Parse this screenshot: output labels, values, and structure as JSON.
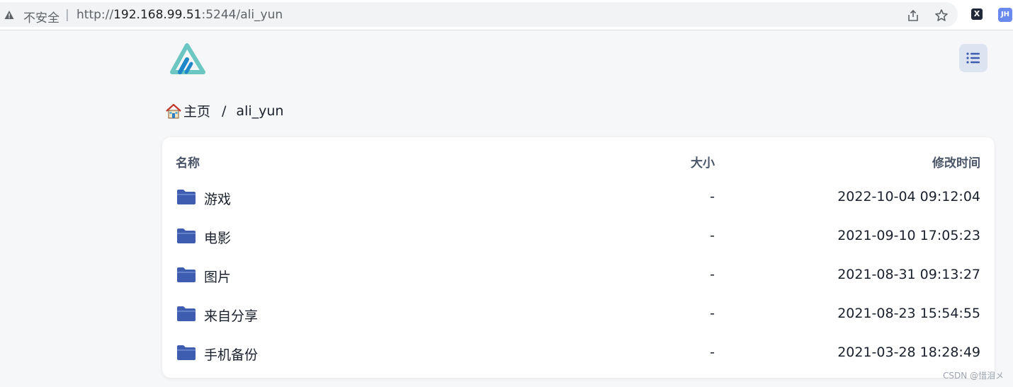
{
  "browser": {
    "security_label": "不安全",
    "separator": "|",
    "url_scheme": "http://",
    "url_host": "192.168.99.51",
    "url_rest": ":5244/ali_yun",
    "ext1_label": "X",
    "ext2_label": "JH"
  },
  "breadcrumb": {
    "home_label": "主页",
    "separator": "/",
    "current": "ali_yun"
  },
  "table": {
    "headers": {
      "name": "名称",
      "size": "大小",
      "modified": "修改时间"
    },
    "rows": [
      {
        "name": "游戏",
        "size": "-",
        "modified": "2022-10-04 09:12:04"
      },
      {
        "name": "电影",
        "size": "-",
        "modified": "2021-09-10 17:05:23"
      },
      {
        "name": "图片",
        "size": "-",
        "modified": "2021-08-31 09:13:27"
      },
      {
        "name": "来自分享",
        "size": "-",
        "modified": "2021-08-23 15:54:55"
      },
      {
        "name": "手机备份",
        "size": "-",
        "modified": "2021-03-28 18:28:49"
      }
    ]
  },
  "watermark": "CSDN @惜泪メ",
  "colors": {
    "folder": "#3f5db0",
    "accent": "#4a6fc2",
    "logo_teal": "#6cc7c2",
    "logo_blue": "#1e88c8"
  },
  "icons": [
    "warning-icon",
    "share-icon",
    "star-icon",
    "logo-icon",
    "list-icon",
    "home-icon",
    "folder-icon"
  ]
}
